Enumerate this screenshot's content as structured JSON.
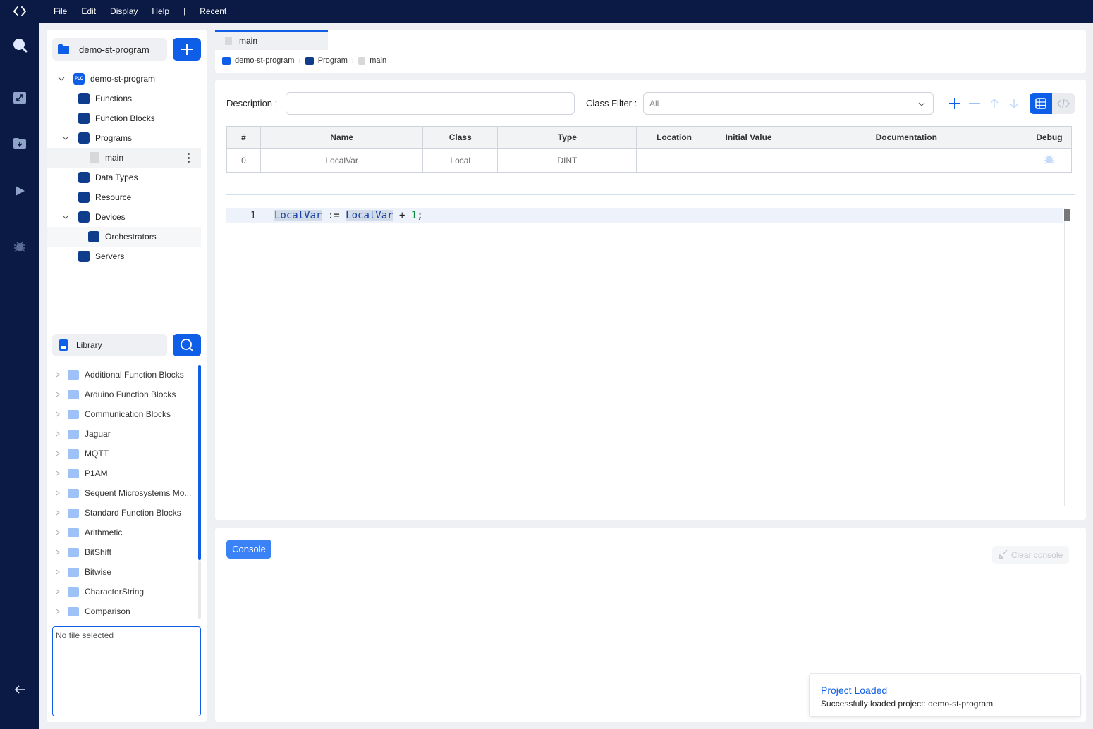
{
  "menu": {
    "items": [
      "File",
      "Edit",
      "Display",
      "Help",
      "|",
      "Recent"
    ]
  },
  "explorer": {
    "project_name": "demo-st-program",
    "tree": {
      "root": "demo-st-program",
      "functions": "Functions",
      "function_blocks": "Function Blocks",
      "programs": "Programs",
      "main": "main",
      "data_types": "Data Types",
      "resource": "Resource",
      "devices": "Devices",
      "orchestrators": "Orchestrators",
      "servers": "Servers"
    },
    "library_label": "Library",
    "library_items": [
      "Additional Function Blocks",
      "Arduino Function Blocks",
      "Communication Blocks",
      "Jaguar",
      "MQTT",
      "P1AM",
      "Sequent Microsystems Mo...",
      "Standard Function Blocks",
      "Arithmetic",
      "BitShift",
      "Bitwise",
      "CharacterString",
      "Comparison"
    ],
    "file_box_text": "No file selected"
  },
  "tabs": {
    "active": "main"
  },
  "breadcrumb": {
    "project": "demo-st-program",
    "section": "Program",
    "file": "main"
  },
  "editor": {
    "description_label": "Description :",
    "description_value": "",
    "class_filter_label": "Class Filter :",
    "class_filter_value": "All",
    "columns": [
      "#",
      "Name",
      "Class",
      "Type",
      "Location",
      "Initial Value",
      "Documentation",
      "Debug"
    ],
    "rows": [
      {
        "index": "0",
        "name": "LocalVar",
        "class": "Local",
        "type": "DINT",
        "location": "",
        "initial_value": "",
        "documentation": ""
      }
    ],
    "code": {
      "line_number": "1",
      "var1": "LocalVar",
      "op1": " := ",
      "var2": "LocalVar",
      "op2": " + ",
      "num": "1",
      "end": ";"
    }
  },
  "console": {
    "button_label": "Console",
    "clear_label": "Clear console"
  },
  "toast": {
    "title": "Project Loaded",
    "message": "Successfully loaded project: demo-st-program"
  },
  "colors": {
    "brand": "#0f5ee8",
    "sidebar": "#0b1a45"
  }
}
